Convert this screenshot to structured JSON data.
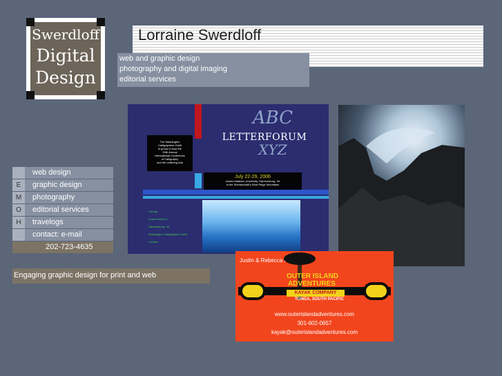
{
  "logo": {
    "line1": "Swerdloff",
    "line2": "Digital",
    "line3": "Design"
  },
  "header": {
    "title": "Lorraine Swerdloff",
    "taglines": [
      "web and graphic design",
      "photography and digital imaging",
      "editorial services"
    ]
  },
  "nav": {
    "letters": [
      "",
      "E",
      "M",
      "O",
      "H",
      "",
      ""
    ],
    "items": [
      "web design",
      "graphic design",
      "photography",
      "editorial services",
      "travelogs",
      "contact: e-mail"
    ],
    "phone": "202-723-4635"
  },
  "description": "Engaging graphic design for print and web",
  "letterforum": {
    "title_script": "ABC",
    "title": "LETTERFORUM",
    "subtitle_script": "XYZ",
    "intro": [
      "The Washington",
      "Calligraphers Guild",
      "is proud to host the",
      "25th Annual",
      "International Conference",
      "of Calligraphy",
      "and the Lettering Arts"
    ],
    "dates": "July 22-29, 2006",
    "location": [
      "James Madison University, Harrisonburg, VA",
      "in the Shenandoah's Blue Ridge Mountains"
    ],
    "links": [
      "Faculty",
      "Leave Online A",
      "Harrisonburg, VA",
      "Washington Calligraphers Guild",
      "Contact"
    ]
  },
  "card": {
    "names": "Justin & Rebecca Freedman",
    "brand1": "OUTER ISLAND",
    "brand2": "ADVENTURES",
    "kayak": "KAYAK COMPANY",
    "place": "TONGA, SOUTH PACIFIC",
    "web": "www.outerislandadventures.com",
    "phone": "301-602-0657",
    "email": "kayak@outerislandadventures.com"
  }
}
